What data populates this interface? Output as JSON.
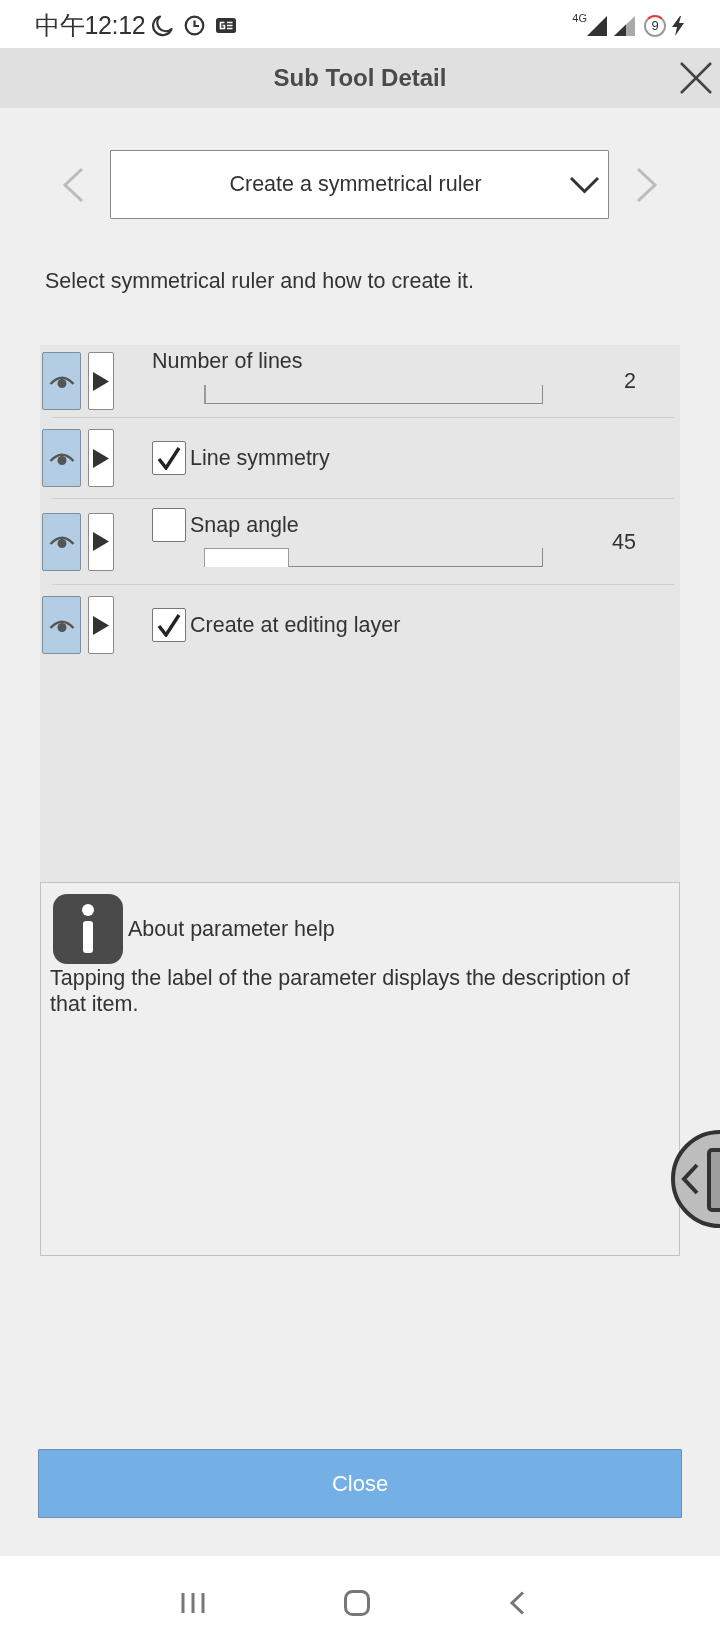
{
  "status_bar": {
    "time": "中午12:12",
    "network": "4G",
    "battery_percent": "9"
  },
  "header": {
    "title": "Sub Tool Detail"
  },
  "selector": {
    "value": "Create a symmetrical ruler"
  },
  "description": "Select symmetrical ruler and how to create it.",
  "parameters": [
    {
      "kind": "slider",
      "label": "Number of lines",
      "visible": true,
      "level": 0,
      "value": "2"
    },
    {
      "kind": "checkbox",
      "label": "Line symmetry",
      "visible": true,
      "checked": true
    },
    {
      "kind": "checkbox_slider",
      "label": "Snap angle",
      "visible": true,
      "checked": false,
      "level": 0.245,
      "value": "45"
    },
    {
      "kind": "checkbox",
      "label": "Create at editing layer",
      "visible": true,
      "checked": true
    }
  ],
  "help": {
    "title": "About parameter help",
    "text": "Tapping the label of the parameter displays the description of that item."
  },
  "close_button": {
    "label": "Close"
  }
}
